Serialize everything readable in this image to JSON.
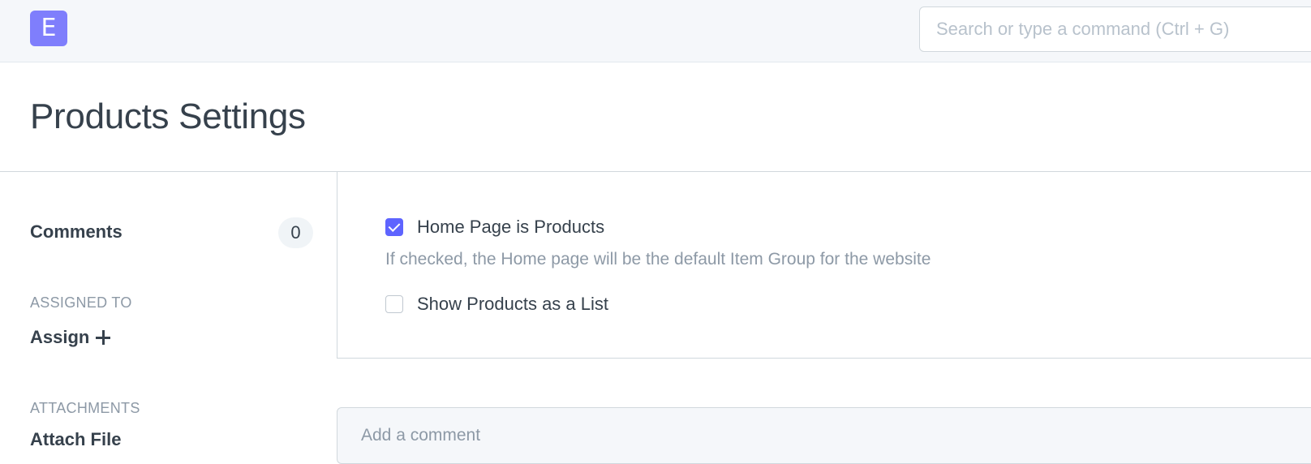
{
  "navbar": {
    "logo_letter": "E",
    "search_placeholder": "Search or type a command (Ctrl + G)"
  },
  "page": {
    "title": "Products Settings"
  },
  "sidebar": {
    "comments_label": "Comments",
    "comments_count": "0",
    "assigned_to_label": "ASSIGNED TO",
    "assign_label": "Assign",
    "attachments_label": "ATTACHMENTS",
    "attach_file_label": "Attach File"
  },
  "form": {
    "fields": [
      {
        "label": "Home Page is Products",
        "checked": true,
        "help": "If checked, the Home page will be the default Item Group for the website"
      },
      {
        "label": "Show Products as a List",
        "checked": false
      }
    ]
  },
  "comment": {
    "placeholder": "Add a comment"
  },
  "colors": {
    "accent": "#5e64ff",
    "logo_bg": "#7f7efc",
    "navbar_bg": "#f5f7fa",
    "text": "#36414c",
    "muted_text": "#8d99a6"
  }
}
